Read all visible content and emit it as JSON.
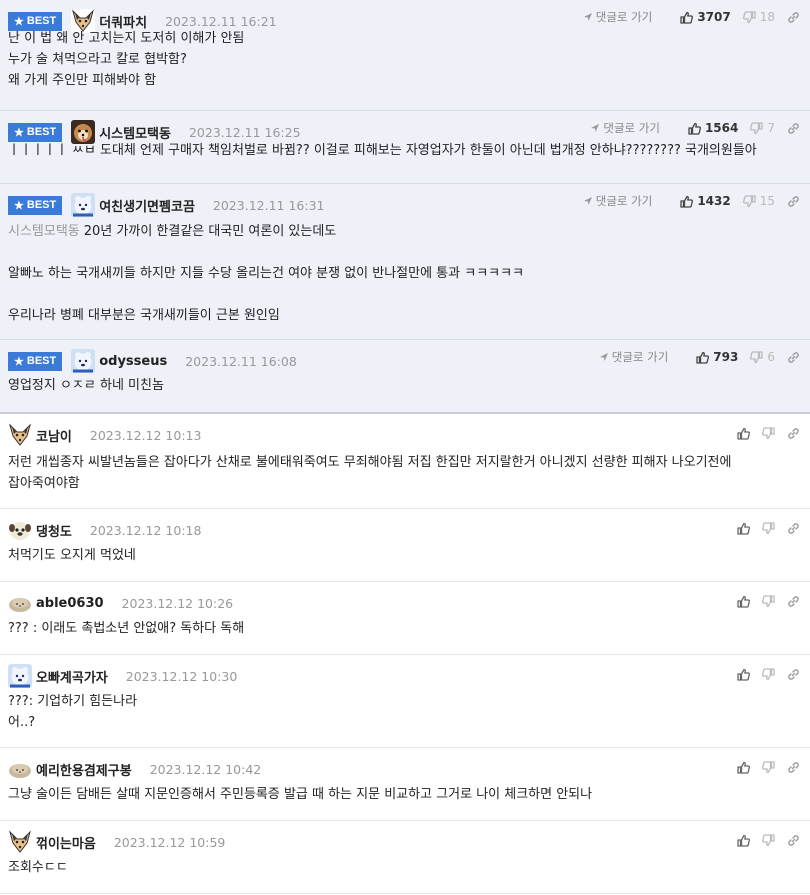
{
  "common": {
    "best_label": "BEST",
    "goto_label": "댓글로 가기"
  },
  "comments": [
    {
      "best": true,
      "avatar": "fox-avatar",
      "nick": "더쿼파치",
      "date": "2023.12.11 16:21",
      "up": "3707",
      "down": "18",
      "lines": [
        "난 이 법 왜 안 고치는지 도저히 이해가 안됨",
        "누가 술 쳐먹으라고 칼로 협박함?",
        "왜 가게 주인만 피해봐야 함"
      ]
    },
    {
      "best": true,
      "avatar": "dog-avatar",
      "nick": "시스템모택동",
      "date": "2023.12.11 16:25",
      "up": "1564",
      "down": "7",
      "lines": [
        "ㅣㅣㅣㅣㅣ ㅆㅂ 도대체 언제 구매자 책임처벌로 바뀜?? 이걸로 피해보는 자영업자가 한둘이 아닌데 법개정 안하냐???????? 국개의원들아"
      ]
    },
    {
      "best": true,
      "avatar": "bear-avatar",
      "nick": "여친생기면펨코끔",
      "date": "2023.12.11 16:31",
      "up": "1432",
      "down": "15",
      "reply_to": "시스템모택동",
      "lines": [
        "20년 가까이 한결같은 대국민 여론이 있는데도",
        "",
        "알빠노 하는 국개새끼들 하지만 지들 수당 올리는건 여야 분쟁 없이 반나절만에 통과 ㅋㅋㅋㅋㅋ",
        "",
        "우리나라 병폐 대부분은 국개새끼들이 근본 원인임"
      ]
    },
    {
      "best": true,
      "avatar": "bear-avatar",
      "nick": "odysseus",
      "date": "2023.12.11 16:08",
      "up": "793",
      "down": "6",
      "lines": [
        "영업정지 ㅇㅈㄹ 하네 미친놈"
      ]
    },
    {
      "best": false,
      "avatar": "fox-avatar",
      "nick": "코남이",
      "date": "2023.12.12 10:13",
      "lines": [
        "저런 개씹종자 씨발년놈들은 잡아다가 산채로 불에태워죽여도 무죄해야됨 저집 한집만 저지랄한거 아니겠지 선량한 피해자 나오기전에",
        "잡아죽여야함"
      ]
    },
    {
      "best": false,
      "avatar": "pug-avatar",
      "nick": "댕청도",
      "date": "2023.12.12 10:18",
      "lines": [
        "처먹기도 오지게 먹었네"
      ]
    },
    {
      "best": false,
      "avatar": "blob-avatar",
      "nick": "able0630",
      "date": "2023.12.12 10:26",
      "lines": [
        "??? : 이래도 촉법소년 안없애? 독하다 독해"
      ]
    },
    {
      "best": false,
      "avatar": "bear-avatar",
      "nick": "오빠계곡가자",
      "date": "2023.12.12 10:30",
      "lines": [
        "???: 기업하기 힘든나라",
        "어..?"
      ]
    },
    {
      "best": false,
      "avatar": "blob-avatar",
      "nick": "예리한용겸제구봉",
      "date": "2023.12.12 10:42",
      "lines": [
        "그냥 술이든 담배든 살때 지문인증해서 주민등록증 발급 때 하는 지문 비교하고 그거로 나이 체크하면 안되나"
      ]
    },
    {
      "best": false,
      "avatar": "fox-avatar",
      "nick": "꺾이는마음",
      "date": "2023.12.12 10:59",
      "lines": [
        "조회수ㄷㄷ"
      ]
    }
  ]
}
